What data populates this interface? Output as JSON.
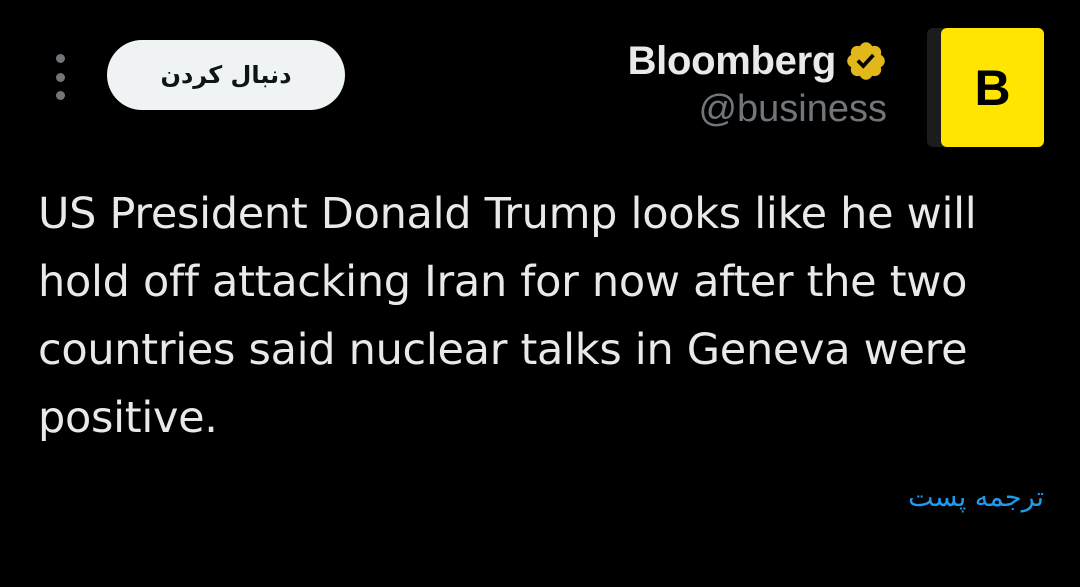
{
  "account": {
    "display_name": "Bloomberg",
    "handle": "@business",
    "avatar_letter": "B",
    "avatar_color": "#ffe500",
    "verified_badge_color": "#e2b719",
    "verified_icon": "verified-badge-icon"
  },
  "actions": {
    "follow_label": "دنبال کردن",
    "more_icon": "more-vertical-icon"
  },
  "tweet": {
    "text": "US President Donald Trump looks like he will hold off attacking Iran for now after the two countries said nuclear talks in Geneva were positive.",
    "translate_label": "ترجمه پست"
  },
  "theme": {
    "background": "#000000",
    "text_primary": "#e7e9ea",
    "text_secondary": "#71767b",
    "link": "#1d9bf0"
  }
}
